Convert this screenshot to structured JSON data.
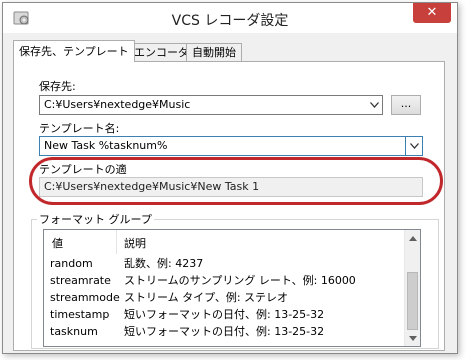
{
  "window": {
    "title": "VCS レコーダ設定",
    "close_label": "✕"
  },
  "tabs": [
    {
      "label": "保存先、テンプレート",
      "active": true
    },
    {
      "label": "エンコーダ",
      "active": false
    },
    {
      "label": "自動開始",
      "active": false
    }
  ],
  "save": {
    "label": "保存先:",
    "path_value": "C:¥Users¥nextedge¥Music",
    "browse_label": "..."
  },
  "template": {
    "label": "テンプレート名:",
    "value": "New Task %tasknum%"
  },
  "preview": {
    "label": "テンプレートの適",
    "value": "C:¥Users¥nextedge¥Music¥New Task 1"
  },
  "format_group": {
    "title": "フォーマット グループ",
    "columns": [
      "値",
      "説明"
    ],
    "rows": [
      {
        "value": "random",
        "description": "乱数、例: 4237"
      },
      {
        "value": "streamrate",
        "description": "ストリームのサンプリング レート、例: 16000"
      },
      {
        "value": "streammode",
        "description": "ストリーム タイプ、例: ステレオ"
      },
      {
        "value": "timestamp",
        "description": "短いフォーマットの日付、例: 13-25-32"
      },
      {
        "value": "tasknum",
        "description": "短いフォーマットの日付、例: 13-25-32"
      }
    ]
  },
  "colors": {
    "highlight": "#c0282c",
    "close_button": "#c7403b",
    "focus_border": "#3c7fb1"
  }
}
